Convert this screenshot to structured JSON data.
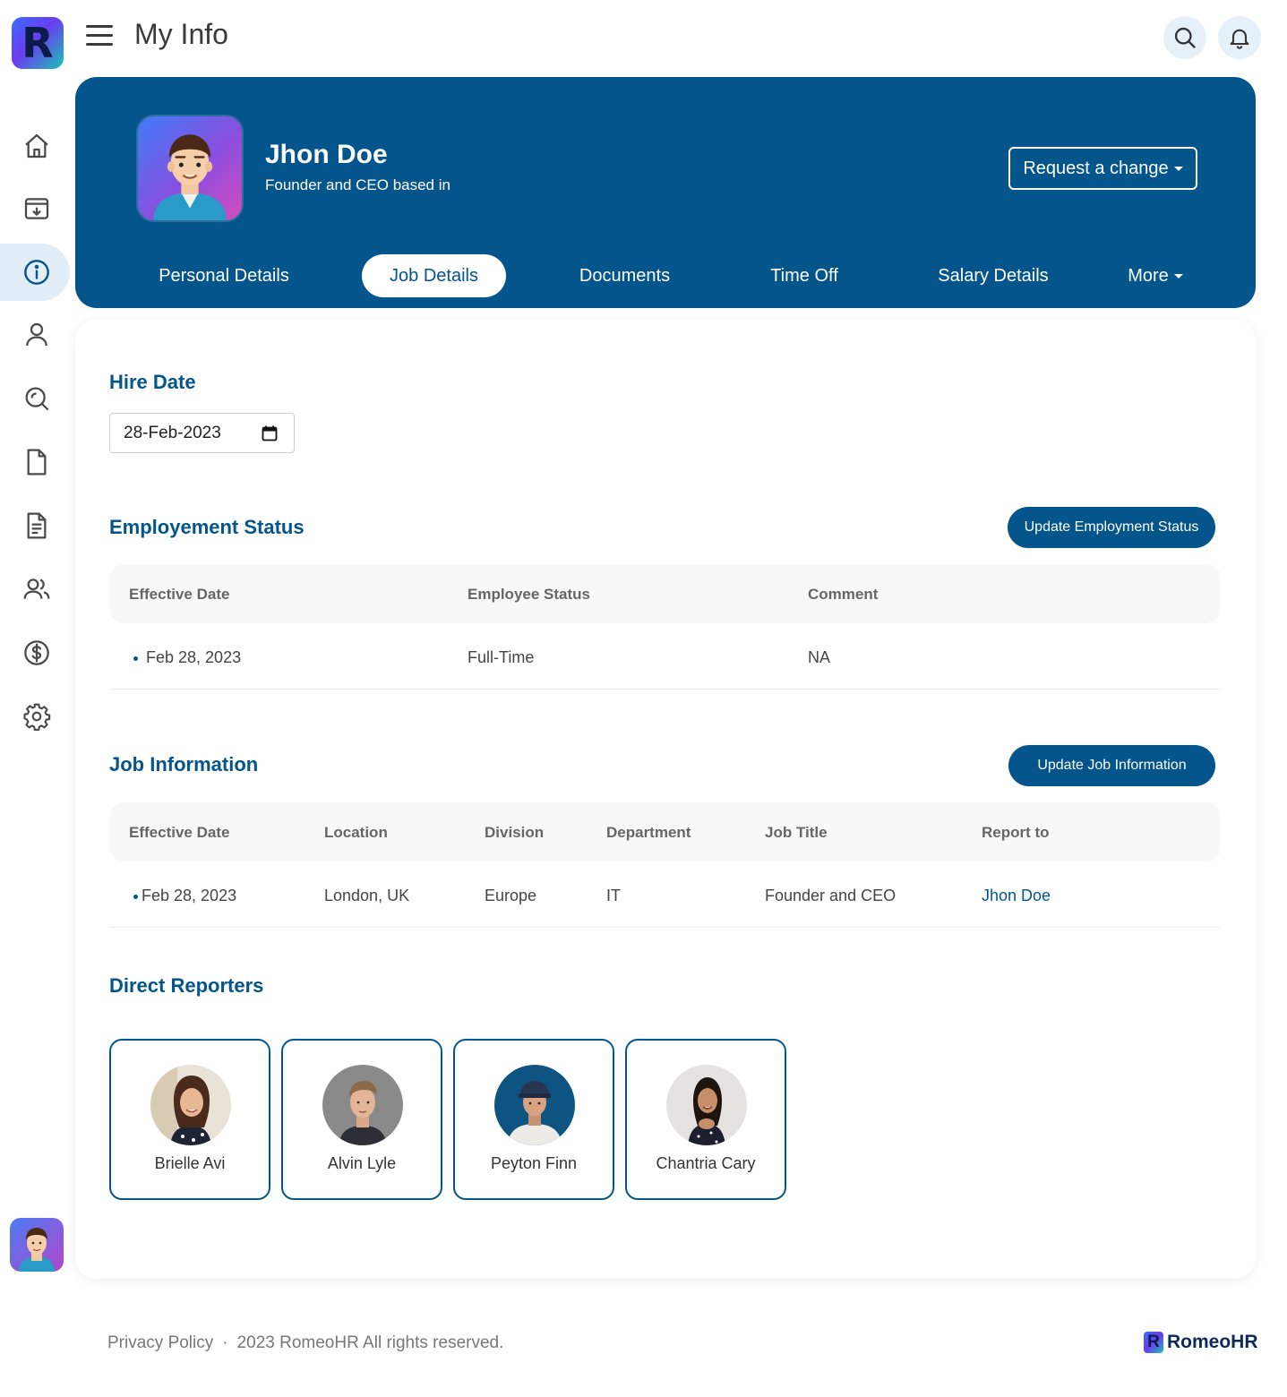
{
  "app": {
    "logo_letter": "R",
    "page_title": "My Info"
  },
  "topbar": {
    "search_icon": "search-icon",
    "bell_icon": "bell-icon"
  },
  "sidebar": {
    "items": [
      {
        "name": "home",
        "icon": "home-icon",
        "active": false
      },
      {
        "name": "inbox",
        "icon": "inbox-download-icon",
        "active": false
      },
      {
        "name": "my-info",
        "icon": "info-icon",
        "active": true
      },
      {
        "name": "person",
        "icon": "person-icon",
        "active": false
      },
      {
        "name": "search",
        "icon": "zoom-search-icon",
        "active": false
      },
      {
        "name": "file",
        "icon": "file-icon",
        "active": false
      },
      {
        "name": "document",
        "icon": "document-lines-icon",
        "active": false
      },
      {
        "name": "team",
        "icon": "team-icon",
        "active": false
      },
      {
        "name": "payroll",
        "icon": "dollar-icon",
        "active": false
      },
      {
        "name": "settings",
        "icon": "gear-icon",
        "active": false
      }
    ]
  },
  "profile": {
    "name": "Jhon Doe",
    "subtitle": "Founder and CEO based in",
    "request_change_label": "Request a change"
  },
  "tabs": [
    {
      "label": "Personal Details",
      "active": false
    },
    {
      "label": "Job Details",
      "active": true
    },
    {
      "label": "Documents",
      "active": false
    },
    {
      "label": "Time Off",
      "active": false
    },
    {
      "label": "Salary Details",
      "active": false
    },
    {
      "label": "More",
      "active": false
    }
  ],
  "hire_date": {
    "title": "Hire Date",
    "value": "28-Feb-2023"
  },
  "employment_status": {
    "title": "Employement Status",
    "button_label": "Update Employment Status",
    "columns": [
      "Effective Date",
      "Employee Status",
      "Comment"
    ],
    "rows": [
      [
        "Feb 28, 2023",
        "Full-Time",
        "NA"
      ]
    ]
  },
  "job_information": {
    "title": "Job Information",
    "button_label": "Update Job Information",
    "columns": [
      "Effective Date",
      "Location",
      "Division",
      "Department",
      "Job Title",
      "Report to"
    ],
    "rows": [
      [
        "Feb 28, 2023",
        "London, UK",
        "Europe",
        "IT",
        "Founder and CEO",
        "Jhon Doe"
      ]
    ]
  },
  "direct_reporters": {
    "title": "Direct Reporters",
    "people": [
      {
        "name": "Brielle Avi"
      },
      {
        "name": "Alvin Lyle"
      },
      {
        "name": "Peyton Finn"
      },
      {
        "name": "Chantria Cary"
      }
    ]
  },
  "footer": {
    "privacy_label": "Privacy Policy",
    "separator": "·",
    "copyright": "2023 RomeoHR All rights reserved.",
    "brand_letter": "R",
    "brand_name": "RomeoHR"
  },
  "colors": {
    "primary": "#03558b",
    "active_bg": "#e1edf7",
    "icon": "#4a4a4a"
  }
}
